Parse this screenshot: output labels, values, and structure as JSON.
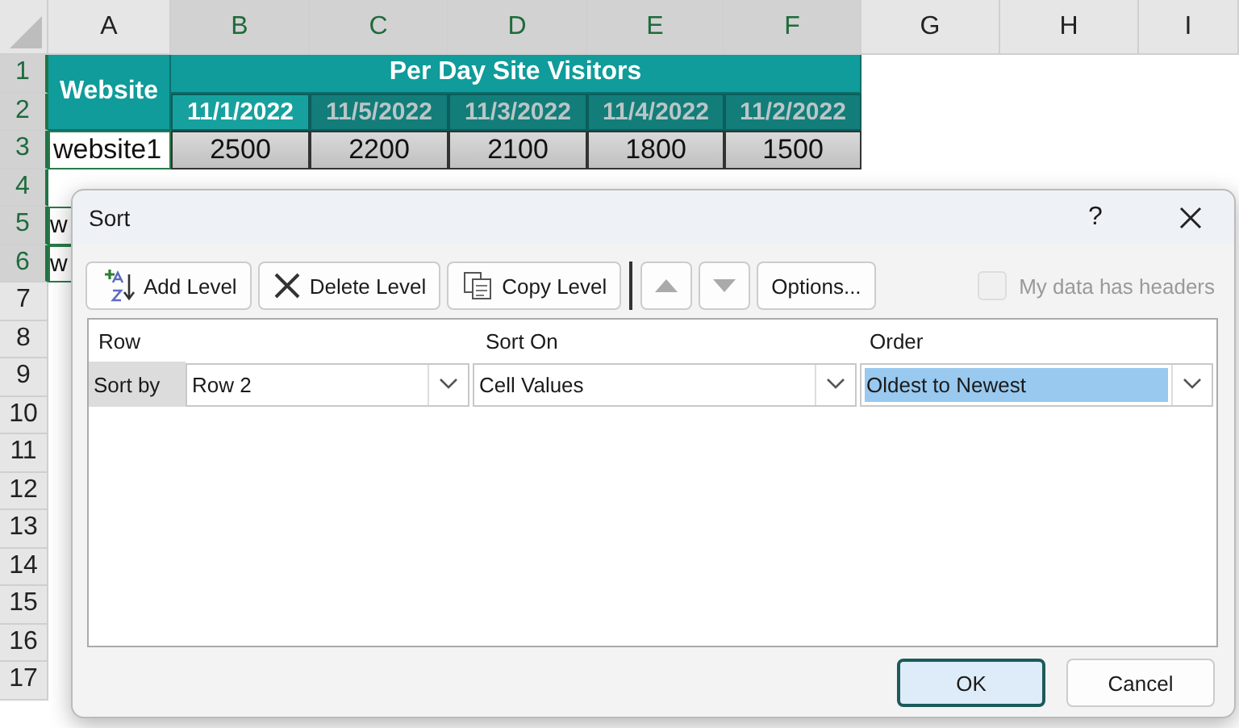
{
  "sheet": {
    "columns": [
      {
        "label": "A",
        "selected": false
      },
      {
        "label": "B",
        "selected": true
      },
      {
        "label": "C",
        "selected": true
      },
      {
        "label": "D",
        "selected": true
      },
      {
        "label": "E",
        "selected": true
      },
      {
        "label": "F",
        "selected": true
      },
      {
        "label": "G",
        "selected": false
      },
      {
        "label": "H",
        "selected": false
      },
      {
        "label": "I",
        "selected": false
      }
    ],
    "rows": [
      {
        "label": "1",
        "selected": true
      },
      {
        "label": "2",
        "selected": true
      },
      {
        "label": "3",
        "selected": true
      },
      {
        "label": "4",
        "selected": true
      },
      {
        "label": "5",
        "selected": true
      },
      {
        "label": "6",
        "selected": true
      },
      {
        "label": "7",
        "selected": false
      },
      {
        "label": "8",
        "selected": false
      },
      {
        "label": "9",
        "selected": false
      },
      {
        "label": "10",
        "selected": false
      },
      {
        "label": "11",
        "selected": false
      },
      {
        "label": "12",
        "selected": false
      },
      {
        "label": "13",
        "selected": false
      },
      {
        "label": "14",
        "selected": false
      },
      {
        "label": "15",
        "selected": false
      },
      {
        "label": "16",
        "selected": false
      },
      {
        "label": "17",
        "selected": false
      }
    ],
    "website_header": "Website",
    "title": "Per Day Site Visitors",
    "dates": [
      {
        "text": "11/1/2022",
        "selected": true
      },
      {
        "text": "11/5/2022",
        "selected": false
      },
      {
        "text": "11/3/2022",
        "selected": false
      },
      {
        "text": "11/4/2022",
        "selected": false
      },
      {
        "text": "11/2/2022",
        "selected": false
      }
    ],
    "data_row": {
      "name": "website1",
      "values": [
        "2500",
        "2200",
        "2100",
        "1800",
        "1500"
      ]
    },
    "partial_cells": [
      "w",
      "w"
    ]
  },
  "dialog": {
    "title": "Sort",
    "help": "?",
    "toolbar": [
      {
        "kind": "add",
        "label": "Add Level"
      },
      {
        "kind": "delete",
        "label": "Delete Level"
      },
      {
        "kind": "copy",
        "label": "Copy Level"
      },
      {
        "kind": "up"
      },
      {
        "kind": "down"
      },
      {
        "kind": "text",
        "label": "Options..."
      }
    ],
    "headers_checkbox": {
      "label": "My data has headers",
      "checked": false,
      "disabled": true
    },
    "columns": [
      "Row",
      "Sort On",
      "Order"
    ],
    "levels": [
      {
        "label": "Sort by",
        "row": "Row 2",
        "sort_on": "Cell Values",
        "order": "Oldest to Newest",
        "order_selected": true
      }
    ],
    "buttons": [
      {
        "label": "OK",
        "default": true
      },
      {
        "label": "Cancel",
        "default": false
      }
    ]
  }
}
